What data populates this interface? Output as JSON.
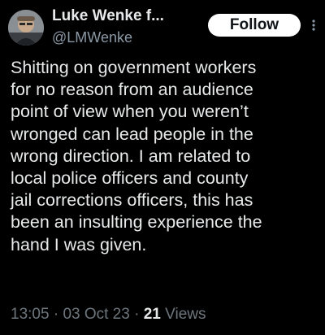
{
  "author": {
    "display_name": "Luke Wenke f...",
    "handle": "@LMWenke"
  },
  "follow_button": {
    "label": "Follow"
  },
  "more_icon": "more-vertical-icon",
  "tweet": {
    "lines": [
      "Shitting on government workers",
      "for no reason from an audience",
      "point of view when you weren’t",
      "wronged can lead people in the",
      "wrong direction.  I am related to",
      "local police officers and county",
      "jail corrections officers, this has",
      "been an insulting experience the",
      "hand I was given."
    ]
  },
  "meta": {
    "time": "13:05",
    "separator": "·",
    "date": "03 Oct 23",
    "views_count": "21",
    "views_label": "Views"
  },
  "colors": {
    "background": "#000000",
    "text_primary": "#e7e9ea",
    "text_secondary": "#6e767d",
    "button_bg": "#ffffff",
    "button_text": "#0f1419"
  }
}
